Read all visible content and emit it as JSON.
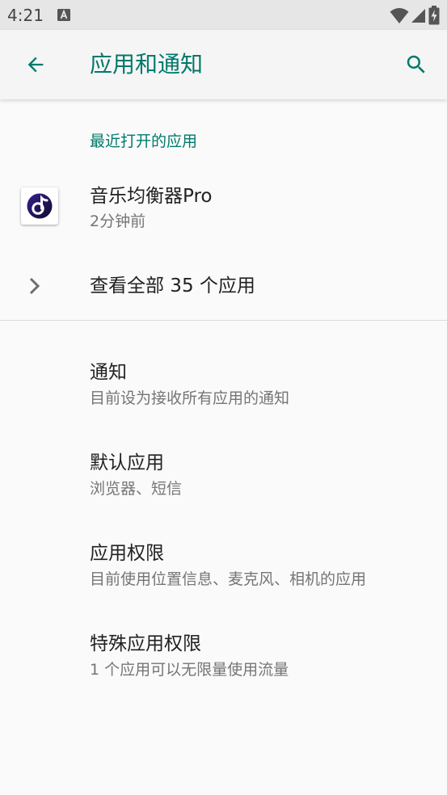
{
  "status_bar": {
    "time": "4:21",
    "icons": [
      "notification-a-icon",
      "wifi-icon",
      "signal-icon",
      "battery-charging-icon"
    ]
  },
  "app_bar": {
    "title": "应用和通知",
    "back_icon": "arrow-back-icon",
    "search_icon": "search-icon"
  },
  "colors": {
    "accent": "#00796b",
    "primary_text": "#212121",
    "secondary_text": "#757575",
    "background": "#fafafa",
    "status_bar": "#e6e6e6",
    "app_bar": "#f5f5f5"
  },
  "recent": {
    "header": "最近打开的应用",
    "apps": [
      {
        "name": "音乐均衡器Pro",
        "time": "2分钟前",
        "icon": "music-note-icon"
      }
    ],
    "see_all": "查看全部 35 个应用"
  },
  "settings": [
    {
      "title": "通知",
      "summary": "目前设为接收所有应用的通知"
    },
    {
      "title": "默认应用",
      "summary": "浏览器、短信"
    },
    {
      "title": "应用权限",
      "summary": "目前使用位置信息、麦克风、相机的应用"
    },
    {
      "title": "特殊应用权限",
      "summary": "1 个应用可以无限量使用流量"
    }
  ]
}
